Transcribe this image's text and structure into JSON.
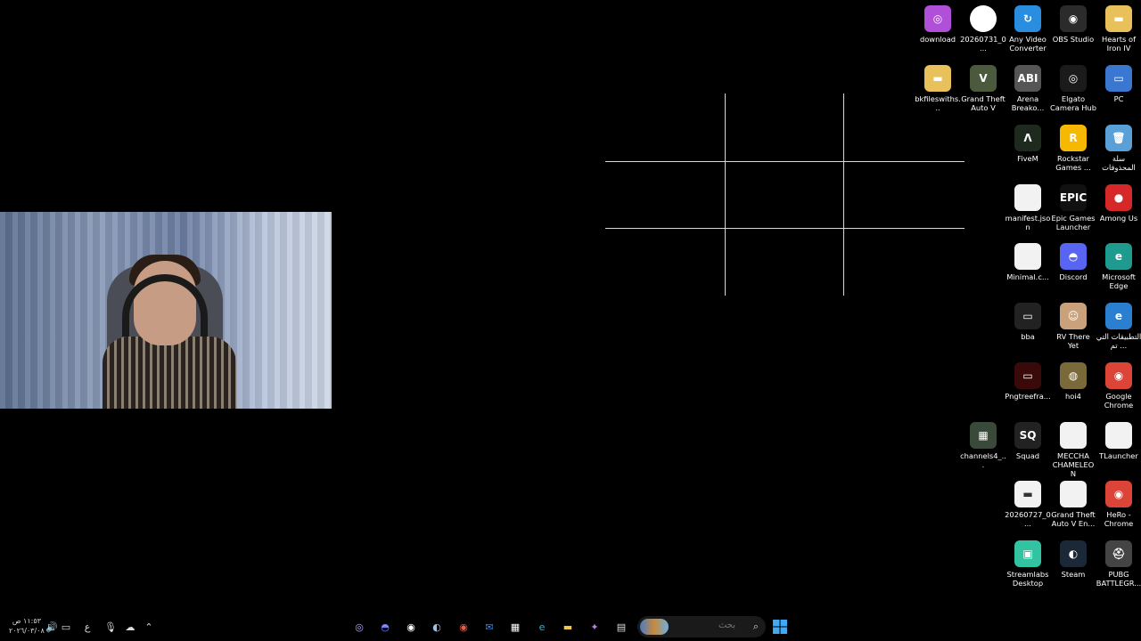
{
  "desktop": {
    "icons": [
      {
        "label": "download",
        "glyph": "◎",
        "color": "#b04fd8"
      },
      {
        "label": "20260731_0...",
        "glyph": "",
        "color": "#ffffff"
      },
      {
        "label": "Any Video Converter",
        "glyph": "↻",
        "color": "#2a8ee0"
      },
      {
        "label": "OBS Studio",
        "glyph": "◉",
        "color": "#2b2b2b"
      },
      {
        "label": "Hearts of Iron IV",
        "glyph": "▬",
        "color": "#e8c15a"
      },
      {
        "label": "bkfileswiths...",
        "glyph": "▬",
        "color": "#e8c15a"
      },
      {
        "label": "Grand Theft Auto V",
        "glyph": "V",
        "color": "#4b5a3d"
      },
      {
        "label": "Arena Breako...",
        "glyph": "ABI",
        "color": "#555555"
      },
      {
        "label": "Elgato Camera Hub",
        "glyph": "◎",
        "color": "#1b1b1b"
      },
      {
        "label": "PC",
        "glyph": "▭",
        "color": "#3a77d0"
      },
      {
        "label": "FiveM",
        "glyph": "Λ",
        "color": "#1f2a1f"
      },
      {
        "label": "Rockstar Games ...",
        "glyph": "R",
        "color": "#f6b800"
      },
      {
        "label": "سلة المحذوفات",
        "glyph": "🗑",
        "color": "#5aa0d8"
      },
      {
        "label": "manifest.json",
        "glyph": "",
        "color": "#f2f2f2"
      },
      {
        "label": "Epic Games Launcher",
        "glyph": "EPIC",
        "color": "#111111"
      },
      {
        "label": "Among Us",
        "glyph": "●",
        "color": "#d62828"
      },
      {
        "label": "Minimal.c...",
        "glyph": "",
        "color": "#f2f2f2"
      },
      {
        "label": "Discord",
        "glyph": "◓",
        "color": "#5865f2"
      },
      {
        "label": "Microsoft Edge",
        "glyph": "e",
        "color": "#1f9a8f"
      },
      {
        "label": "bba",
        "glyph": "▭",
        "color": "#222222"
      },
      {
        "label": "RV There Yet",
        "glyph": "☺",
        "color": "#c9a27b"
      },
      {
        "label": "التطبيقات التي تم ...",
        "glyph": "e",
        "color": "#2b7fd1"
      },
      {
        "label": "Pngtreefra...",
        "glyph": "▭",
        "color": "#3a0a0a"
      },
      {
        "label": "hoi4",
        "glyph": "◍",
        "color": "#7a6a3a"
      },
      {
        "label": "Google Chrome",
        "glyph": "◉",
        "color": "#db4437"
      },
      {
        "label": "channels4_...",
        "glyph": "▦",
        "color": "#3a4a3a"
      },
      {
        "label": "Squad",
        "glyph": "SQ",
        "color": "#222222"
      },
      {
        "label": "MECCHA CHAMELEON",
        "glyph": "",
        "color": "#f2f2f2"
      },
      {
        "label": "TLauncher",
        "glyph": "",
        "color": "#f2f2f2"
      },
      {
        "label": "20260727_0...",
        "glyph": "▬",
        "color": "#f2f2f2"
      },
      {
        "label": "Grand Theft Auto V En...",
        "glyph": "",
        "color": "#f2f2f2"
      },
      {
        "label": "HeRo - Chrome",
        "glyph": "◉",
        "color": "#db4437"
      },
      {
        "label": "Streamlabs Desktop",
        "glyph": "▣",
        "color": "#31c3a2"
      },
      {
        "label": "Steam",
        "glyph": "◐",
        "color": "#1b2838"
      },
      {
        "label": "PUBG BATTLEGR...",
        "glyph": "⛑",
        "color": "#444444"
      }
    ]
  },
  "taskbar": {
    "clock_time": "١١:٥٣ ص",
    "clock_date": "٢٠٢٦/٠٣/٠٨",
    "language": "ع",
    "search_placeholder": "بحث",
    "tray_icons": [
      "speaker-icon",
      "battery-icon",
      "mic-icon",
      "onedrive-icon",
      "chevron-up-icon"
    ],
    "pinned_icons": [
      "copilot-icon",
      "discord-icon",
      "obs-icon",
      "steam-icon",
      "chrome-icon",
      "mail-icon",
      "store-icon",
      "edge-icon",
      "file-explorer-icon",
      "app-icon",
      "notepad-icon"
    ]
  }
}
